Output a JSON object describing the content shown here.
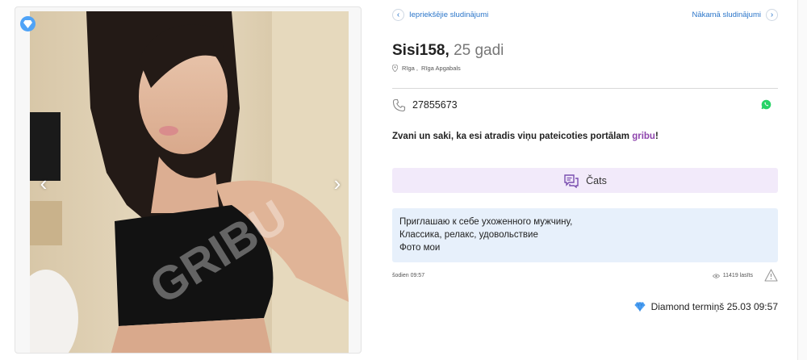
{
  "gallery": {
    "watermark": "GRIBU",
    "prev_arrow": "‹",
    "next_arrow": "›",
    "badge_icon": "diamond-icon"
  },
  "nav": {
    "prev_label": "Iepriekšējie sludinājumi",
    "next_label": "Nākamā sludinājumi",
    "prev_glyph": "‹",
    "next_glyph": "›"
  },
  "listing": {
    "name": "Sisi158,",
    "age": "25 gadi",
    "city": "Rīga ,",
    "region": "Rīga Apgabals",
    "phone": "27855673",
    "call_text": "Zvani un saki, ka esi atradis viņu pateicoties portālam",
    "brand": "gribu",
    "brand_suffix": "!",
    "chat_label": "Čats",
    "description": [
      "Приглашаю к себе ухоженного мужчину,",
      "Классика, релакс, удовольствие",
      "Фото мои"
    ],
    "posted": "šodien 09:57",
    "views": "11419 lasīts",
    "diamond_term": "Diamond termiņš 25.03 09:57"
  },
  "colors": {
    "link": "#2a75c9",
    "brand": "#8e44ad",
    "chat_bg": "#f2eafa",
    "desc_bg": "#e7f0fb",
    "whatsapp": "#25d366",
    "diamond": "#4fa3f7"
  }
}
